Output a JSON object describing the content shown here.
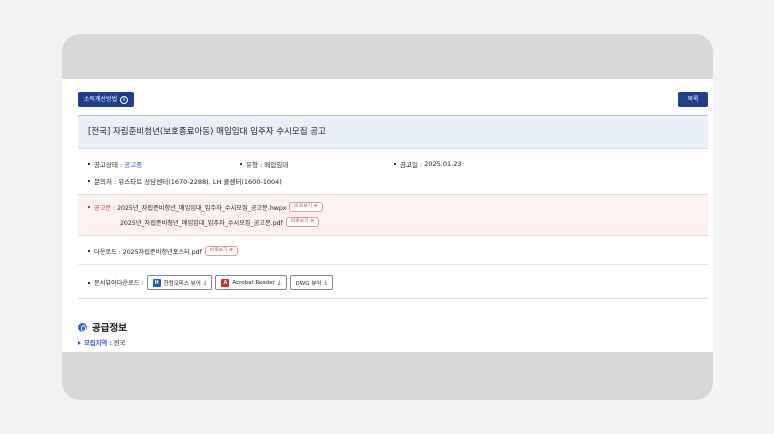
{
  "toolbar": {
    "income_button_label": "소득계산방법",
    "info_icon": "ⓘ",
    "list_button_label": "목록"
  },
  "notice": {
    "title": "[전국] 자립준비청년(보호종료아동) 매입임대 입주자 수시모집 공고"
  },
  "info": {
    "status_label": "공고상태 :",
    "status_value": "공고중",
    "type_label": "유형 :",
    "type_value": "매입임대",
    "date_label": "공고일 :",
    "date_value": "2025.01.23",
    "contact_label": "문의처 :",
    "contact_value": "유스타트 상담센터(1670-2288), LH 콜센터(1600-1004)"
  },
  "notice_files": {
    "label": "공고문 :",
    "files": [
      {
        "name": "2025년_자립준비청년_매입임대_입주자_수시모집_공고문.hwpx",
        "preview": "바로보기 ⊕"
      },
      {
        "name": "2025년_자립준비청년_매입임대_입주자_수시모집_공고문.pdf",
        "preview": "바로보기 ⊕"
      }
    ]
  },
  "downloads": {
    "label": "다운로드 :",
    "file": "2025자립준비청년포스터.pdf",
    "preview": "바로보기 ⊕"
  },
  "viewers": {
    "label": "문서뷰어다운로드 :",
    "items": [
      {
        "label": "한컴오피스 뷰어",
        "icon_text": "H"
      },
      {
        "label": "Acrobat Reader",
        "icon_text": "A"
      },
      {
        "label": "DWG 뷰어",
        "icon_text": ""
      }
    ],
    "download_glyph": "⤓"
  },
  "supply": {
    "heading": "공급정보",
    "region_label": "모집지역 :",
    "region_value": "전국"
  }
}
